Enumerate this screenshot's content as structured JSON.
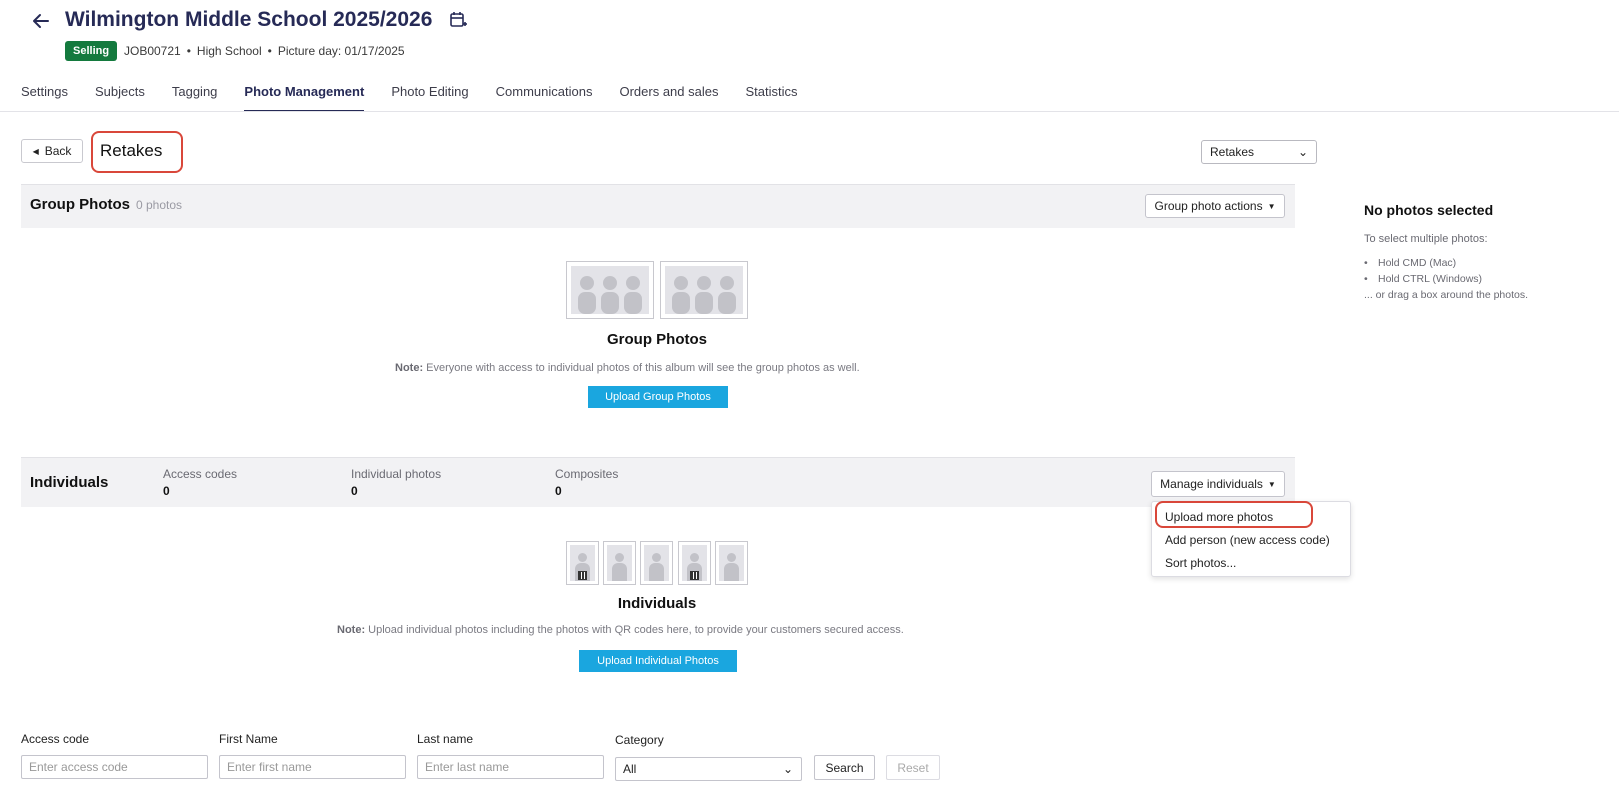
{
  "header": {
    "title": "Wilmington Middle School 2025/2026",
    "status_badge": "Selling",
    "job_id": "JOB00721",
    "school_type": "High School",
    "picture_day": "Picture day: 01/17/2025",
    "separator": "•"
  },
  "tabs": [
    {
      "label": "Settings"
    },
    {
      "label": "Subjects"
    },
    {
      "label": "Tagging"
    },
    {
      "label": "Photo Management",
      "active": true
    },
    {
      "label": "Photo Editing"
    },
    {
      "label": "Communications"
    },
    {
      "label": "Orders and sales"
    },
    {
      "label": "Statistics"
    }
  ],
  "toolbar": {
    "back_label": "Back",
    "page_title": "Retakes",
    "album_select_value": "Retakes"
  },
  "group_photos": {
    "title": "Group Photos",
    "count": "0 photos",
    "actions_label": "Group photo actions",
    "empty_heading": "Group Photos",
    "note_prefix": "Note:",
    "note_text": " Everyone with access to individual photos of this album will see the group photos as well.",
    "upload_label": "Upload Group Photos"
  },
  "individuals": {
    "title": "Individuals",
    "stats": [
      {
        "label": "Access codes",
        "value": "0"
      },
      {
        "label": "Individual photos",
        "value": "0"
      },
      {
        "label": "Composites",
        "value": "0"
      }
    ],
    "manage_label": "Manage individuals",
    "menu": [
      "Upload more photos",
      "Add person (new access code)",
      "Sort photos..."
    ],
    "empty_heading": "Individuals",
    "note_prefix": "Note:",
    "note_text": " Upload individual photos including the photos with QR codes here, to provide your customers secured access.",
    "upload_label": "Upload Individual Photos"
  },
  "selection_panel": {
    "title": "No photos selected",
    "subtitle": "To select multiple photos:",
    "tips": [
      "Hold CMD (Mac)",
      "Hold CTRL (Windows)"
    ],
    "tail": "... or drag a box around the photos."
  },
  "search_form": {
    "access_code_label": "Access code",
    "access_code_placeholder": "Enter access code",
    "first_name_label": "First Name",
    "first_name_placeholder": "Enter first name",
    "last_name_label": "Last name",
    "last_name_placeholder": "Enter last name",
    "category_label": "Category",
    "category_value": "All",
    "search_label": "Search",
    "reset_label": "Reset"
  },
  "colors": {
    "brand_navy": "#262a56",
    "badge_green": "#147a3e",
    "upload_blue": "#1aa6df",
    "highlight_red": "#d9473a"
  },
  "icons": [
    "back-arrow-icon",
    "calendar-icon",
    "caret-left-icon",
    "chevron-down-icon",
    "caret-down-icon",
    "group-silhouette-icon",
    "person-silhouette-icon",
    "qr-code-icon"
  ]
}
